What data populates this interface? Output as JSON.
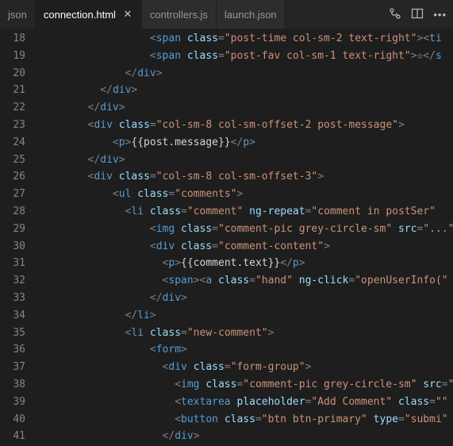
{
  "tabs": {
    "t0": "json",
    "t1": "connection.html",
    "t2": "controllers.js",
    "t3": "launch.json"
  },
  "icons": {
    "compare": "compare-changes-icon",
    "split": "split-editor-icon",
    "more": "more-icon"
  },
  "lines": {
    "l18": "18",
    "l19": "19",
    "l20": "20",
    "l21": "21",
    "l22": "22",
    "l23": "23",
    "l24": "24",
    "l25": "25",
    "l26": "26",
    "l27": "27",
    "l28": "28",
    "l29": "29",
    "l30": "30",
    "l31": "31",
    "l32": "32",
    "l33": "33",
    "l34": "34",
    "l35": "35",
    "l36": "36",
    "l37": "37",
    "l38": "38",
    "l39": "39",
    "l40": "40",
    "l41": "41"
  },
  "code": {
    "r18": {
      "indent": "                  ",
      "tag": "span",
      "attrs": [
        [
          "class",
          "post-time col-sm-2 text-right"
        ]
      ],
      "after": "><ti"
    },
    "r19": {
      "indent": "                  ",
      "tag": "span",
      "attrs": [
        [
          "class",
          "post-fav col-sm-1 text-right"
        ]
      ],
      "after": ">☆</s"
    },
    "r20": {
      "indent": "              ",
      "close": "div"
    },
    "r21": {
      "indent": "          ",
      "close": "div"
    },
    "r22": {
      "indent": "        ",
      "close": "div"
    },
    "r23": {
      "indent": "        ",
      "tag": "div",
      "attrs": [
        [
          "class",
          "col-sm-8 col-sm-offset-2 post-message"
        ]
      ],
      "after": ">"
    },
    "r24": {
      "indent": "            ",
      "tag": "p",
      "attrs": [],
      "after": ">",
      "text": "{{post.message}}",
      "closeTag": "p"
    },
    "r25": {
      "indent": "        ",
      "close": "div"
    },
    "r26": {
      "indent": "        ",
      "tag": "div",
      "attrs": [
        [
          "class",
          "col-sm-8 col-sm-offset-3"
        ]
      ],
      "after": ">"
    },
    "r27": {
      "indent": "            ",
      "tag": "ul",
      "attrs": [
        [
          "class",
          "comments"
        ]
      ],
      "after": ">"
    },
    "r28": {
      "indent": "              ",
      "tag": "li",
      "attrs": [
        [
          "class",
          "comment"
        ],
        [
          "ng-repeat",
          "comment in postSer"
        ]
      ],
      "after": ""
    },
    "r29": {
      "indent": "                  ",
      "tag": "img",
      "attrs": [
        [
          "class",
          "comment-pic grey-circle-sm"
        ],
        [
          "src",
          "..."
        ]
      ],
      "after": ""
    },
    "r30": {
      "indent": "                  ",
      "tag": "div",
      "attrs": [
        [
          "class",
          "comment-content"
        ]
      ],
      "after": ">"
    },
    "r31": {
      "indent": "                    ",
      "tag": "p",
      "attrs": [],
      "after": ">",
      "text": "{{comment.text}}",
      "closeTag": "p"
    },
    "r32": {
      "indent": "                    ",
      "tag": "span",
      "attrs": [],
      "after": ">",
      "then": {
        "tag": "a",
        "attrs": [
          [
            "class",
            "hand"
          ],
          [
            "ng-click",
            "openUserInfo("
          ]
        ],
        "after": ""
      }
    },
    "r33": {
      "indent": "                  ",
      "close": "div"
    },
    "r34": {
      "indent": "              ",
      "close": "li"
    },
    "r35": {
      "indent": "              ",
      "tag": "li",
      "attrs": [
        [
          "class",
          "new-comment"
        ]
      ],
      "after": ">"
    },
    "r36": {
      "indent": "                  ",
      "tag": "form",
      "attrs": [],
      "after": ">"
    },
    "r37": {
      "indent": "                    ",
      "tag": "div",
      "attrs": [
        [
          "class",
          "form-group"
        ]
      ],
      "after": ">"
    },
    "r38": {
      "indent": "                      ",
      "tag": "img",
      "attrs": [
        [
          "class",
          "comment-pic grey-circle-sm"
        ],
        [
          "src",
          ""
        ]
      ],
      "after": "",
      "tailAttr": " src"
    },
    "r39": {
      "indent": "                      ",
      "tag": "textarea",
      "attrs": [
        [
          "placeholder",
          "Add Comment"
        ],
        [
          "class",
          ""
        ]
      ],
      "after": "",
      "tailAttr": ""
    },
    "r40": {
      "indent": "                      ",
      "tag": "button",
      "attrs": [
        [
          "class",
          "btn btn-primary"
        ],
        [
          "type",
          "submi"
        ]
      ],
      "after": ""
    },
    "r41": {
      "indent": "                    ",
      "close": "div"
    }
  }
}
